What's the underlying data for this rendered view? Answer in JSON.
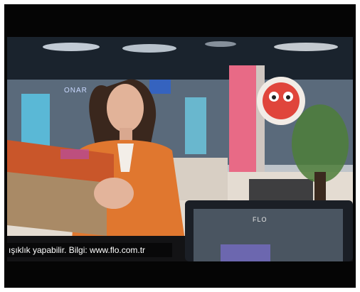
{
  "caption": "ışıklık yapabilir. Bilgi: www.flo.com.tr",
  "store_sign_left": "ONAR",
  "monitor_brand": "FLO",
  "colors": {
    "jacket": "#e0772f",
    "shoebox": "#c9562a",
    "mascot": "#e0453b",
    "screen": "#4a5561"
  }
}
